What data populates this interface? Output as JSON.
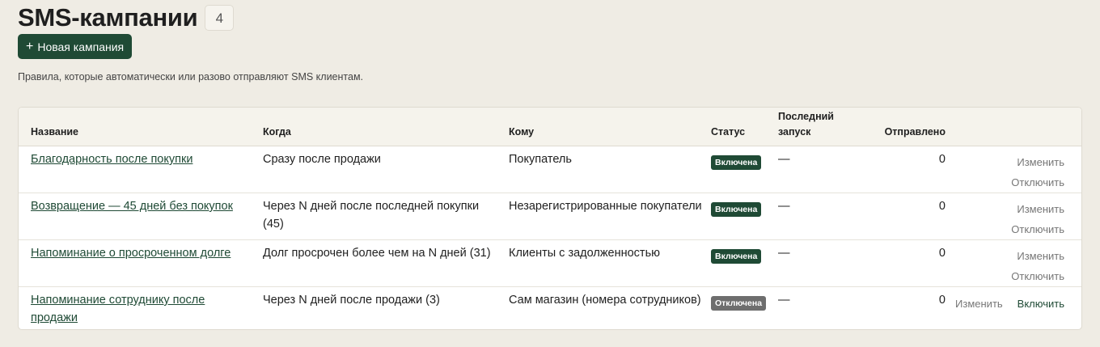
{
  "page": {
    "title": "SMS-кампании",
    "count": "4",
    "new_button": "Новая кампания",
    "subtitle": "Правила, которые автоматически или разово отправляют SMS клиентам."
  },
  "table": {
    "headers": {
      "name": "Название",
      "when": "Когда",
      "who": "Кому",
      "status": "Статус",
      "last_run": "Последний запуск",
      "sent": "Отправлено"
    },
    "rows": [
      {
        "name": "Благодарность после покупки",
        "when": "Сразу после продажи",
        "who": "Покупатель",
        "status": "Включена",
        "last_run": "—",
        "sent": "0",
        "edit": "Изменить",
        "toggle": "Отключить"
      },
      {
        "name": "Возвращение — 45 дней без покупок",
        "when": "Через N дней после последней покупки (45)",
        "who": "Незарегистрированные покупатели",
        "status": "Включена",
        "last_run": "—",
        "sent": "0",
        "edit": "Изменить",
        "toggle": "Отключить"
      },
      {
        "name": "Напоминание о просроченном долге",
        "when": "Долг просрочен более чем на N дней (31)",
        "who": "Клиенты с задолженностью",
        "status": "Включена",
        "last_run": "—",
        "sent": "0",
        "edit": "Изменить",
        "toggle": "Отключить"
      },
      {
        "name": "Напоминание сотруднику после продажи",
        "when": "Через N дней после продажи (3)",
        "who": "Сам магазин (номера сотрудников)",
        "status": "Отключена",
        "last_run": "—",
        "sent": "0",
        "edit": "Изменить",
        "toggle": "Включить"
      }
    ]
  },
  "colors": {
    "background": "#efece4",
    "accent": "#1f4a35",
    "status_on": "#1f4a35",
    "status_off": "#6e6e6e"
  }
}
